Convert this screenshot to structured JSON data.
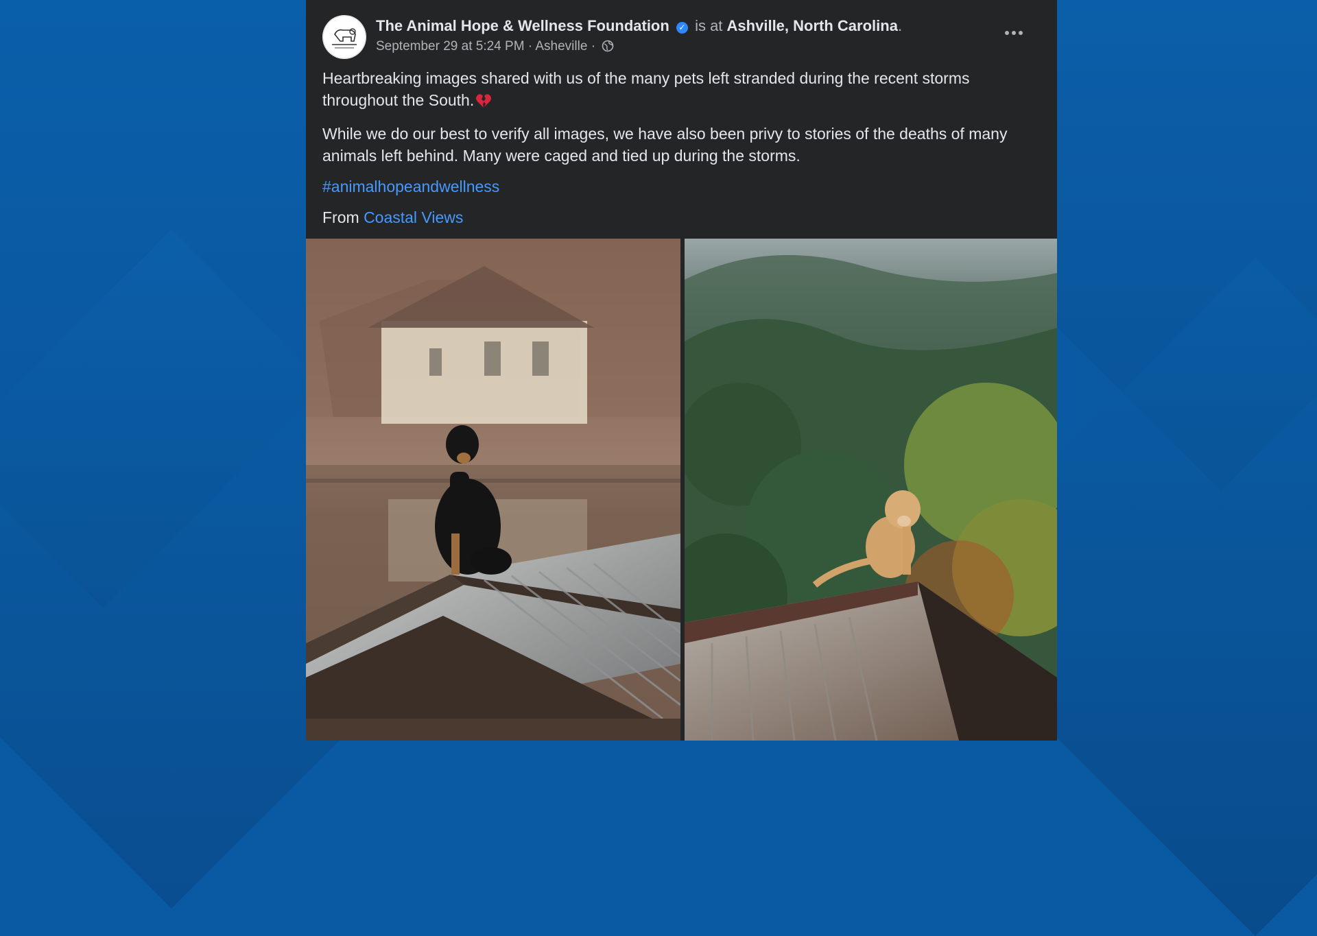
{
  "post": {
    "author": "The Animal Hope & Wellness Foundation",
    "is_at_text": "is at",
    "location": "Ashville, North Carolina",
    "location_period": ".",
    "timestamp": "September 29 at 5:24 PM",
    "separator": "·",
    "place": "Asheville",
    "body_line1": "Heartbreaking images shared with us of the many pets left stranded during the recent storms throughout the South.",
    "body_line2": "While we do our best to verify all images, we have also been privy to stories of the deaths of many animals left behind. Many were caged and tied up during the storms.",
    "hashtag": "#animalhopeandwellness",
    "from_label": "From",
    "from_link": "Coastal Views"
  },
  "icons": {
    "verified": "verified-badge-icon",
    "privacy": "globe-icon",
    "more": "more-options-icon",
    "emoji": "broken-heart-emoji"
  },
  "colors": {
    "card_bg": "#242526",
    "link": "#4599ff",
    "text": "#e4e6eb",
    "muted": "#b0b3b8",
    "page_bg": "#0a5aa3"
  }
}
